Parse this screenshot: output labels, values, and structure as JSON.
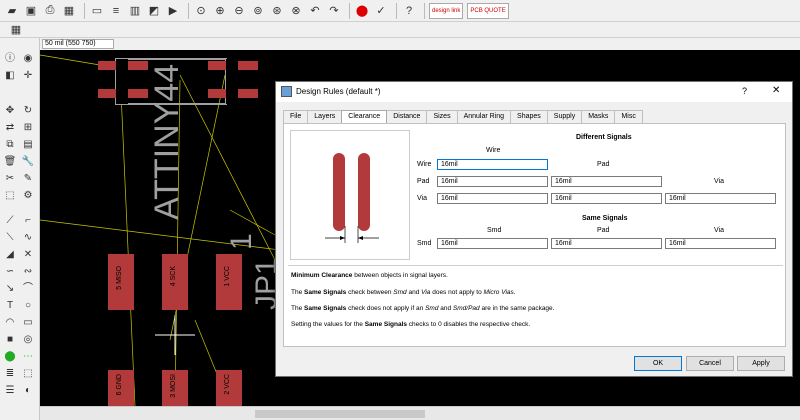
{
  "canvas": {
    "coordinate": "50 mil (550 750)",
    "chip_label": "ATTINY44",
    "part_label_1": "1",
    "part_label_2": "JP1",
    "pads_top": [
      "5 MISO",
      "4 SCK",
      "1 VCC"
    ],
    "pads_bottom": [
      "6 GND",
      "3 MOSI",
      "2 VCC"
    ]
  },
  "dialog": {
    "title": "Design Rules (default *)",
    "help_label": "?",
    "tabs": [
      "File",
      "Layers",
      "Clearance",
      "Distance",
      "Sizes",
      "Annular Ring",
      "Shapes",
      "Supply",
      "Masks",
      "Misc"
    ],
    "active_tab": "Clearance",
    "different_signals": {
      "header": "Different Signals",
      "col_wire": "Wire",
      "col_pad": "Pad",
      "col_via": "Via",
      "row_wire": "Wire",
      "row_pad": "Pad",
      "row_via": "Via",
      "wire_wire": "16mil",
      "pad_wire": "16mil",
      "pad_pad": "16mil",
      "via_wire": "16mil",
      "via_pad": "16mil",
      "via_via": "16mil"
    },
    "same_signals": {
      "header": "Same Signals",
      "col_smd": "Smd",
      "col_pad": "Pad",
      "col_via": "Via",
      "row_smd": "Smd",
      "smd_smd": "16mil",
      "smd_pad": "16mil",
      "smd_via": "16mil"
    },
    "notes": {
      "n1_bold": "Minimum Clearance",
      "n1_rest": " between objects in signal layers.",
      "n2_a": "The ",
      "n2_bold": "Same Signals",
      "n2_b": " check between ",
      "n2_it1": "Smd",
      "n2_c": " and ",
      "n2_it2": "Via",
      "n2_d": " does not apply to ",
      "n2_it3": "Micro Vias",
      "n2_e": ".",
      "n3_a": "The ",
      "n3_bold": "Same Signals",
      "n3_b": " check does not apply if an ",
      "n3_it1": "Smd",
      "n3_c": " and ",
      "n3_it2": "Smd/Pad",
      "n3_d": " are in the same package.",
      "n4_a": "Setting the values for the ",
      "n4_bold": "Same Signals",
      "n4_b": " checks to 0 disables the respective check."
    },
    "buttons": {
      "ok": "OK",
      "cancel": "Cancel",
      "apply": "Apply"
    }
  },
  "toolbar": {
    "logo_1": "design link",
    "logo_2": "PCB QUOTE"
  }
}
